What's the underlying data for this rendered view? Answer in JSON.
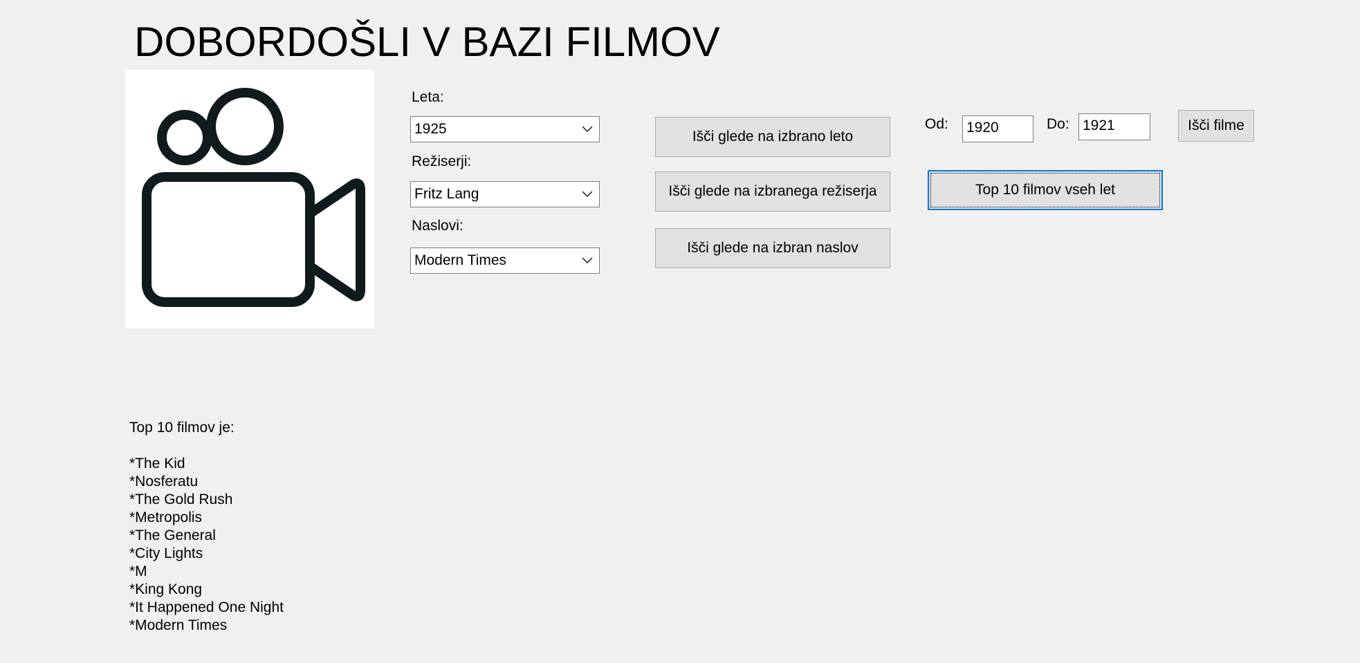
{
  "header": {
    "title": "DOBORDOŠLI V BAZI FILMOV"
  },
  "logo": {
    "icon": "video-camera-icon"
  },
  "filters": {
    "year_label": "Leta:",
    "year_value": "1925",
    "director_label": "Režiserji:",
    "director_value": "Fritz Lang",
    "title_label": "Naslovi:",
    "title_value": "Modern Times"
  },
  "search_buttons": {
    "by_year": "Išči glede na izbrano leto",
    "by_director": "Išči glede na izbranega režiserja",
    "by_title": "Išči glede na izbran naslov"
  },
  "range": {
    "from_label": "Od:",
    "from_value": "1920",
    "to_label": "Do:",
    "to_value": "1921",
    "search_button": "Išči filme"
  },
  "top10_button": "Top 10 filmov vseh let",
  "results": {
    "heading": "Top 10 filmov je:",
    "items": [
      "*The Kid",
      "*Nosferatu",
      "*The Gold Rush",
      "*Metropolis",
      "*The General",
      "*City Lights",
      "*M",
      "*King Kong",
      "*It Happened One Night",
      "*Modern Times"
    ]
  },
  "colors": {
    "background": "#f0f0f0",
    "button": "#e1e1e1",
    "focus_border": "#0078d7",
    "icon": "#111a1c"
  }
}
